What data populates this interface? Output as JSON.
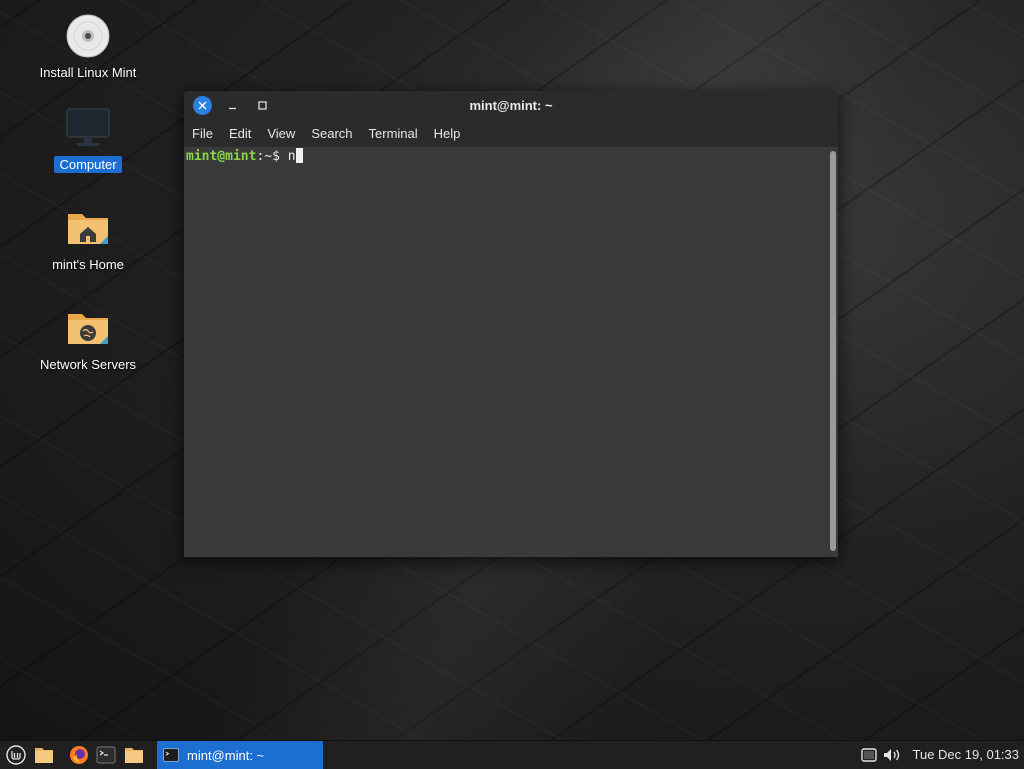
{
  "desktop": {
    "icons": [
      {
        "label": "Install Linux Mint",
        "icon": "disc-icon"
      },
      {
        "label": "Computer",
        "icon": "monitor-icon"
      },
      {
        "label": "mint's Home",
        "icon": "home-folder-icon"
      },
      {
        "label": "Network Servers",
        "icon": "network-folder-icon"
      }
    ]
  },
  "terminal": {
    "title": "mint@mint: ~",
    "menu": [
      "File",
      "Edit",
      "View",
      "Search",
      "Terminal",
      "Help"
    ],
    "prompt": {
      "user_host": "mint@mint",
      "separator": ":",
      "path": "~",
      "symbol": "$ ",
      "typed": "n"
    }
  },
  "panel": {
    "task_label": "mint@mint: ~",
    "clock": "Tue Dec 19, 01:33",
    "launchers": [
      "mint-menu-icon",
      "files-icon",
      "firefox-icon",
      "terminal-icon",
      "folder-icon"
    ],
    "tray": [
      "display-icon",
      "volume-icon"
    ]
  },
  "colors": {
    "accent": "#1c6fd1",
    "prompt_green": "#8ad64a",
    "terminal_bg": "#3a3a3a"
  }
}
